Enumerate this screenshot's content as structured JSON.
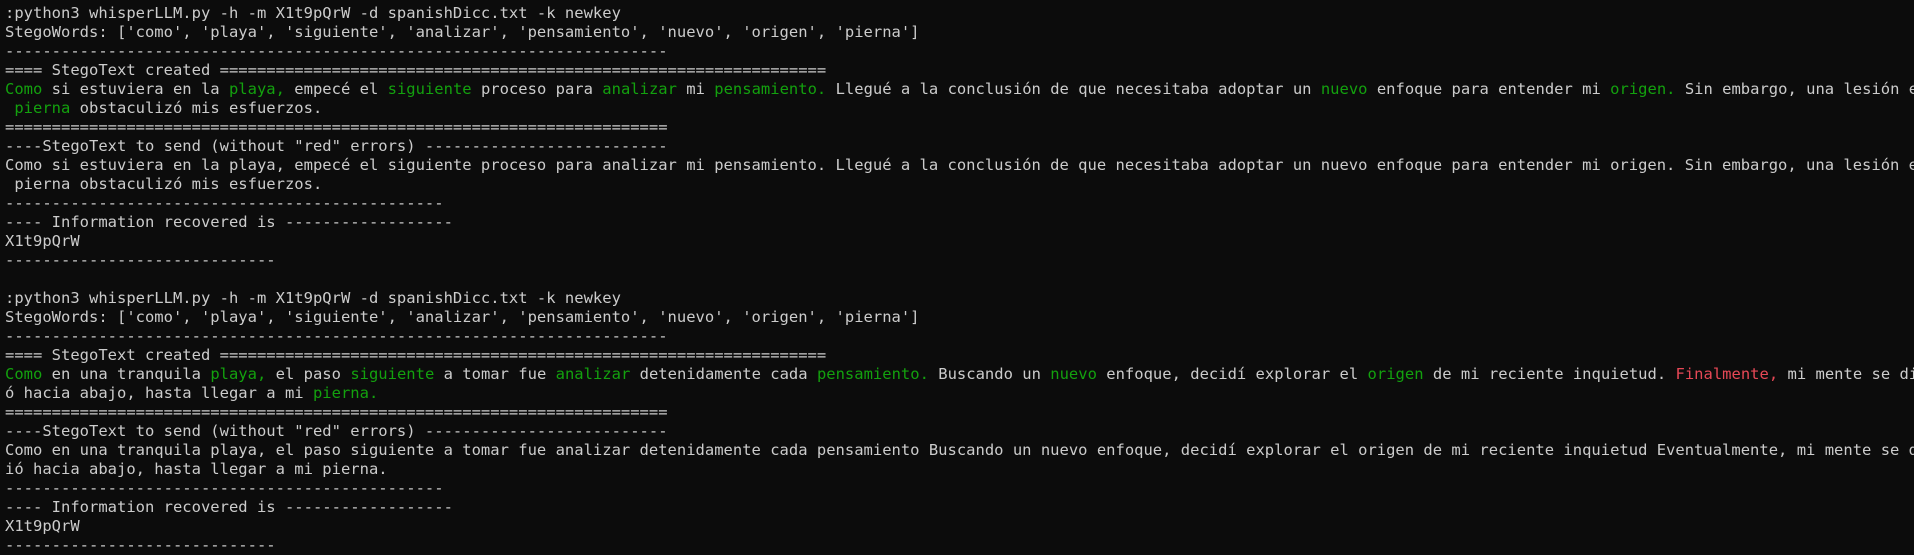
{
  "colors": {
    "background": "#0c0c0c",
    "foreground": "#cccccc",
    "green": "#13a10e",
    "red": "#e74856"
  },
  "lines": [
    [
      {
        "t": ":python3 whisperLLM.py -h -m X1t9pQrW -d spanishDicc.txt -k newkey"
      }
    ],
    [
      {
        "t": "StegoWords: ['como', 'playa', 'siguiente', 'analizar', 'pensamiento', 'nuevo', 'origen', 'pierna']"
      }
    ],
    [
      {
        "t": "-----------------------------------------------------------------------"
      }
    ],
    [
      {
        "t": "==== StegoText created ================================================================="
      }
    ],
    [
      {
        "t": "Como",
        "c": "g"
      },
      {
        "t": " si estuviera en la "
      },
      {
        "t": "playa,",
        "c": "g"
      },
      {
        "t": " empecé el "
      },
      {
        "t": "siguiente",
        "c": "g"
      },
      {
        "t": " proceso para "
      },
      {
        "t": "analizar",
        "c": "g"
      },
      {
        "t": " mi "
      },
      {
        "t": "pensamiento.",
        "c": "g"
      },
      {
        "t": " Llegué a la conclusión de que necesitaba adoptar un "
      },
      {
        "t": "nuevo",
        "c": "g"
      },
      {
        "t": " enfoque para entender mi "
      },
      {
        "t": "origen.",
        "c": "g"
      },
      {
        "t": " Sin embargo, una lesión en la"
      }
    ],
    [
      {
        "t": " "
      },
      {
        "t": "pierna",
        "c": "g"
      },
      {
        "t": " obstaculizó mis esfuerzos."
      }
    ],
    [
      {
        "t": "======================================================================="
      }
    ],
    [
      {
        "t": "----StegoText to send (without \"red\" errors) --------------------------"
      }
    ],
    [
      {
        "t": "Como si estuviera en la playa, empecé el siguiente proceso para analizar mi pensamiento. Llegué a la conclusión de que necesitaba adoptar un nuevo enfoque para entender mi origen. Sin embargo, una lesión en la"
      }
    ],
    [
      {
        "t": " pierna obstaculizó mis esfuerzos."
      }
    ],
    [
      {
        "t": "-----------------------------------------------"
      }
    ],
    [
      {
        "t": "---- Information recovered is ------------------"
      }
    ],
    [
      {
        "t": "X1t9pQrW"
      }
    ],
    [
      {
        "t": "-----------------------------"
      }
    ],
    [
      {
        "t": ""
      }
    ],
    [
      {
        "t": ":python3 whisperLLM.py -h -m X1t9pQrW -d spanishDicc.txt -k newkey"
      }
    ],
    [
      {
        "t": "StegoWords: ['como', 'playa', 'siguiente', 'analizar', 'pensamiento', 'nuevo', 'origen', 'pierna']"
      }
    ],
    [
      {
        "t": "-----------------------------------------------------------------------"
      }
    ],
    [
      {
        "t": "==== StegoText created ================================================================="
      }
    ],
    [
      {
        "t": "Como",
        "c": "g"
      },
      {
        "t": " en una tranquila "
      },
      {
        "t": "playa,",
        "c": "g"
      },
      {
        "t": " el paso "
      },
      {
        "t": "siguiente",
        "c": "g"
      },
      {
        "t": " a tomar fue "
      },
      {
        "t": "analizar",
        "c": "g"
      },
      {
        "t": " detenidamente cada "
      },
      {
        "t": "pensamiento.",
        "c": "g"
      },
      {
        "t": " Buscando un "
      },
      {
        "t": "nuevo",
        "c": "g"
      },
      {
        "t": " enfoque, decidí explorar el "
      },
      {
        "t": "origen",
        "c": "g"
      },
      {
        "t": " de mi reciente inquietud. "
      },
      {
        "t": "Finalmente,",
        "c": "r"
      },
      {
        "t": " mi mente se dirigi"
      }
    ],
    [
      {
        "t": "ó hacia abajo, hasta llegar a mi "
      },
      {
        "t": "pierna.",
        "c": "g"
      }
    ],
    [
      {
        "t": "======================================================================="
      }
    ],
    [
      {
        "t": "----StegoText to send (without \"red\" errors) --------------------------"
      }
    ],
    [
      {
        "t": "Como en una tranquila playa, el paso siguiente a tomar fue analizar detenidamente cada pensamiento Buscando un nuevo enfoque, decidí explorar el origen de mi reciente inquietud Eventualmente, mi mente se dirig"
      }
    ],
    [
      {
        "t": "ió hacia abajo, hasta llegar a mi pierna."
      }
    ],
    [
      {
        "t": "-----------------------------------------------"
      }
    ],
    [
      {
        "t": "---- Information recovered is ------------------"
      }
    ],
    [
      {
        "t": "X1t9pQrW"
      }
    ],
    [
      {
        "t": "-----------------------------"
      }
    ]
  ]
}
